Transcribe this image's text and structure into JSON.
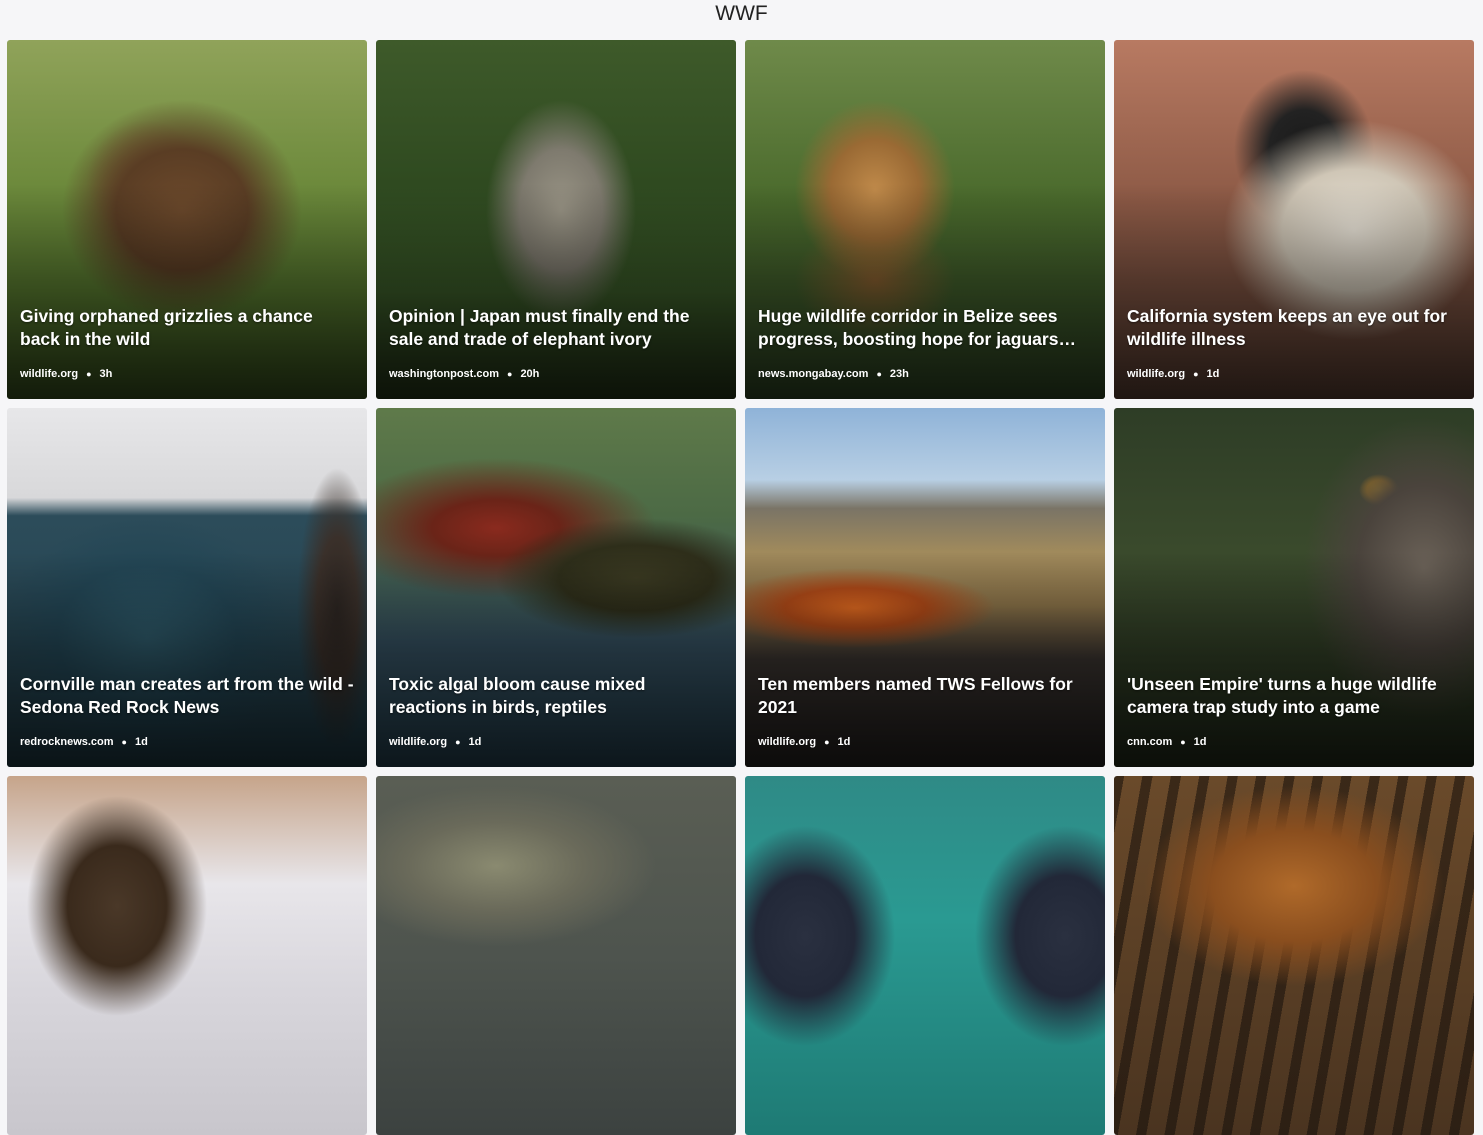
{
  "header": {
    "title": "WWF"
  },
  "cards": [
    {
      "title": "Giving orphaned grizzlies a chance back in the wild",
      "source": "wildlife.org",
      "age": "3h",
      "image": "grizzly-bear-photo"
    },
    {
      "title": "Opinion | Japan must finally end the sale and trade of elephant ivory",
      "source": "washingtonpost.com",
      "age": "20h",
      "image": "elephant-photo"
    },
    {
      "title": "Huge wildlife corridor in Belize sees progress, boosting hope for jaguars…",
      "source": "news.mongabay.com",
      "age": "23h",
      "image": "jaguar-photo"
    },
    {
      "title": "California system keeps an eye out for wildlife illness",
      "source": "wildlife.org",
      "age": "1d",
      "image": "bird-in-towel-photo"
    },
    {
      "title": "Cornville man creates art from the wild - Sedona Red Rock News",
      "source": "redrocknews.com",
      "age": "1d",
      "image": "artist-with-painting-photo"
    },
    {
      "title": "Toxic algal bloom cause mixed reactions in birds, reptiles",
      "source": "wildlife.org",
      "age": "1d",
      "image": "painted-turtle-photo"
    },
    {
      "title": "Ten members named TWS Fellows for 2021",
      "source": "wildlife.org",
      "age": "1d",
      "image": "prescribed-burn-photo"
    },
    {
      "title": "'Unseen Empire' turns a huge wildlife camera trap study into a game",
      "source": "cnn.com",
      "age": "1d",
      "image": "lemur-closeup-photo"
    },
    {
      "title": "",
      "source": "",
      "age": "",
      "image": "wolverine-photo"
    },
    {
      "title": "",
      "source": "",
      "age": "",
      "image": "manatee-photo"
    },
    {
      "title": "",
      "source": "",
      "age": "",
      "image": "pool-animal-photo"
    },
    {
      "title": "",
      "source": "",
      "age": "",
      "image": "tiger-photo"
    }
  ]
}
